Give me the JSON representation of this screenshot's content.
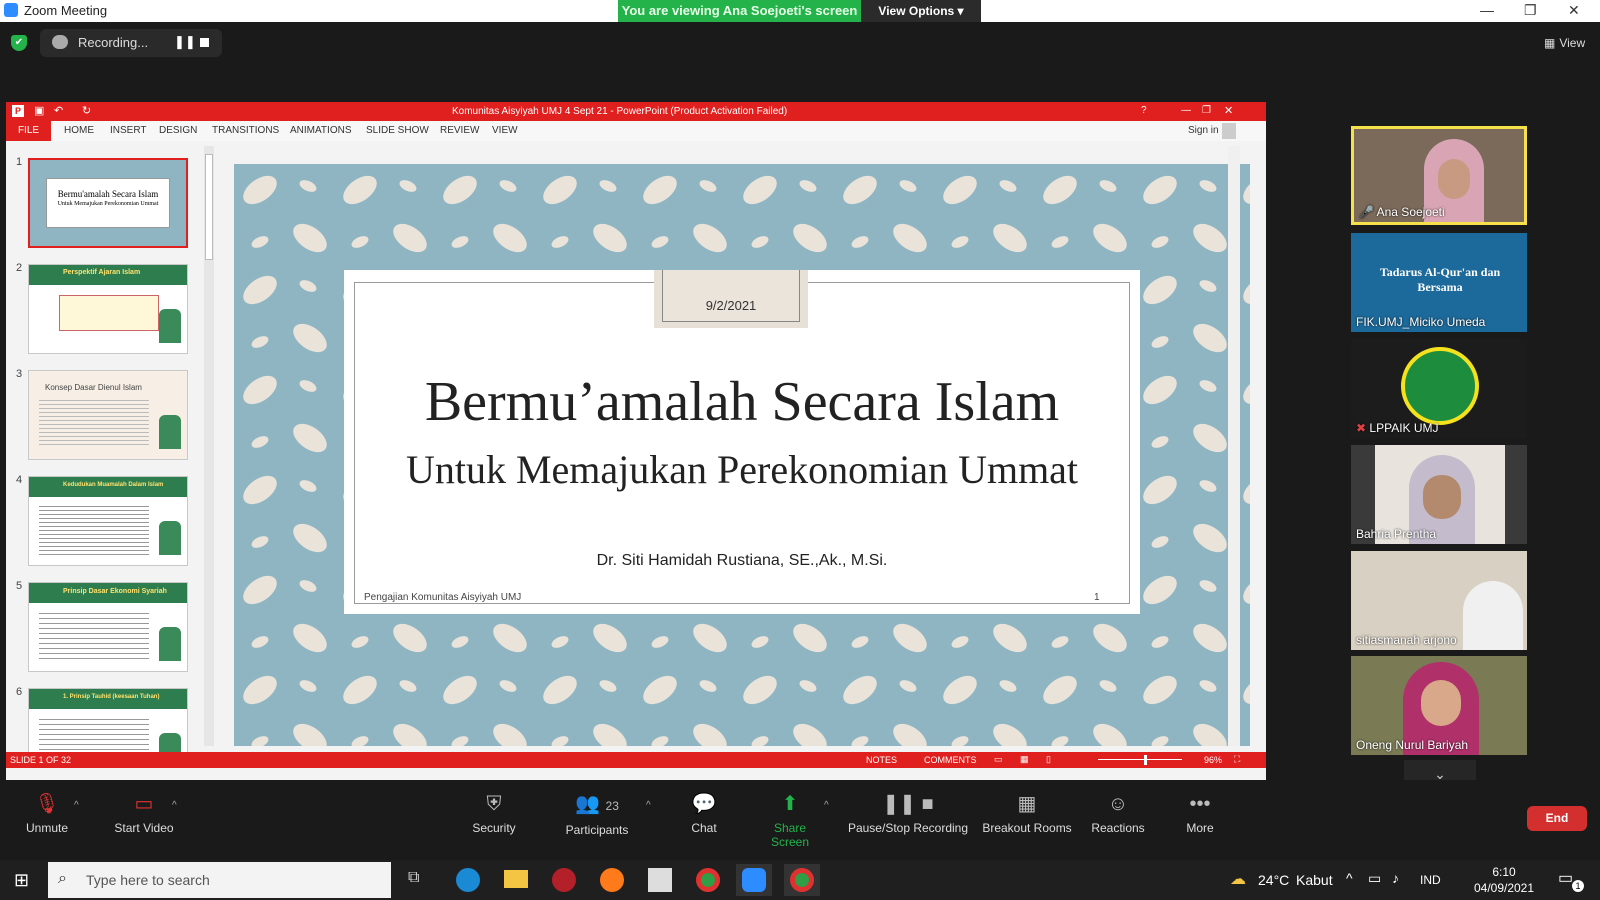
{
  "zoom": {
    "window_title": "Zoom Meeting",
    "viewing_banner": "You are viewing Ana Soejoeti's screen",
    "view_options": "View Options",
    "recording_label": "Recording...",
    "top_view_label": "View",
    "end_label": "End"
  },
  "ppt": {
    "title": "Komunitas Aisyiyah UMJ 4 Sept 21 - PowerPoint (Product Activation Failed)",
    "file_tab": "FILE",
    "menu": [
      "HOME",
      "INSERT",
      "DESIGN",
      "TRANSITIONS",
      "ANIMATIONS",
      "SLIDE SHOW",
      "REVIEW",
      "VIEW"
    ],
    "sign_in": "Sign in",
    "thumbnails": [
      {
        "num": "1",
        "title": "Bermu'amalah Secara Islam",
        "subtitle": "Untuk Memajukan Perekonomian Ummat"
      },
      {
        "num": "2",
        "title": "Perspektif Ajaran Islam"
      },
      {
        "num": "3",
        "title": "Konsep Dasar Dienul Islam"
      },
      {
        "num": "4",
        "title": "Kedudukan Muamalah Dalam Islam"
      },
      {
        "num": "5",
        "title": "Prinsip Dasar Ekonomi Syariah"
      },
      {
        "num": "6",
        "title": "1. Prinsip Tauhid (keesaan Tuhan)"
      }
    ],
    "slide": {
      "date": "9/2/2021",
      "title": "Bermu’amalah Secara Islam",
      "subtitle": "Untuk Memajukan Perekonomian Ummat",
      "author": "Dr. Siti Hamidah Rustiana, SE.,Ak., M.Si.",
      "footer": "Pengajian Komunitas Aisyiyah UMJ",
      "page": "1"
    },
    "status": {
      "slide_of": "SLIDE 1 OF 32",
      "notes": "NOTES",
      "comments": "COMMENTS",
      "zoom": "96%"
    }
  },
  "participants_gallery": [
    {
      "name": "Ana Soejoeti",
      "active": true
    },
    {
      "name": "FIK.UMJ_Miciko Umeda",
      "banner": "Tadarus Al-Qur'an dan Bersama"
    },
    {
      "name": "LPPAIK UMJ",
      "muted": true
    },
    {
      "name": "Bahria Prentha"
    },
    {
      "name": "sitiasmanah arjono"
    },
    {
      "name": "Oneng Nurul Bariyah"
    }
  ],
  "toolbar": {
    "unmute": "Unmute",
    "start_video": "Start Video",
    "security": "Security",
    "participants": "Participants",
    "participant_count": "23",
    "chat": "Chat",
    "share_screen": "Share Screen",
    "pause_stop": "Pause/Stop Recording",
    "breakout": "Breakout Rooms",
    "reactions": "Reactions",
    "more": "More"
  },
  "taskbar": {
    "search_placeholder": "Type here to search",
    "weather_temp": "24°C",
    "weather_desc": "Kabut",
    "lang": "IND",
    "time": "6:10",
    "date": "04/09/2021",
    "notif_count": "1"
  },
  "colors": {
    "ppt_red": "#e0201e",
    "zoom_green": "#23b34a",
    "slide_bg": "#8fb5c3",
    "end_red": "#d32f2f"
  }
}
